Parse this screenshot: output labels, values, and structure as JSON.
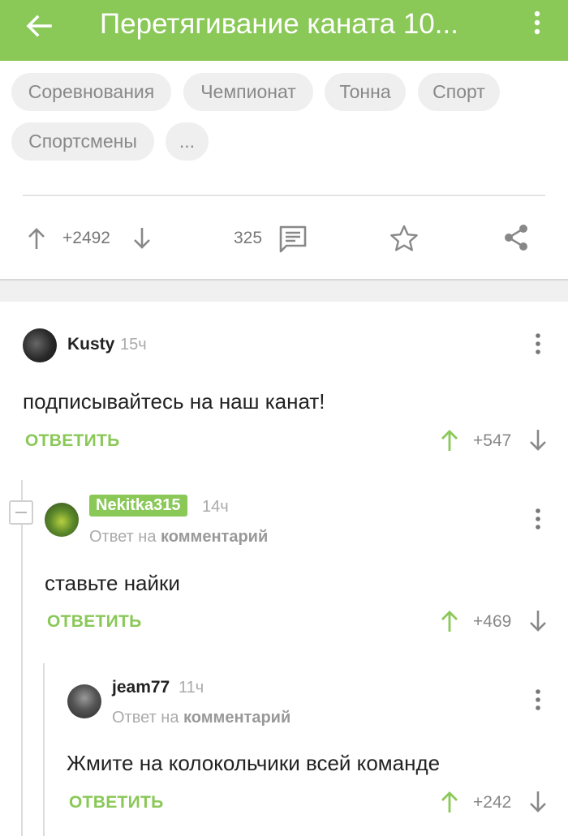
{
  "appbar": {
    "title": "Перетягивание каната 10..."
  },
  "tags": [
    "Соревнования",
    "Чемпионат",
    "Тонна",
    "Спорт",
    "Спортсмены",
    "..."
  ],
  "post_stats": {
    "rating": "+2492",
    "comments_count": "325"
  },
  "comments": [
    {
      "username": "Kusty",
      "time": "15ч",
      "text": "подписывайтесь на наш канат!",
      "reply_label": "ОТВЕТИТЬ",
      "score": "+547"
    },
    {
      "username": "Nekitka315",
      "time": "14ч",
      "reply_prefix": "Ответ на",
      "reply_target": "комментарий",
      "text": "ставьте найки",
      "reply_label": "ОТВЕТИТЬ",
      "score": "+469"
    },
    {
      "username": "jeam77",
      "time": "11ч",
      "reply_prefix": "Ответ на",
      "reply_target": "комментарий",
      "text": "Жмите на колокольчики всей команде",
      "reply_label": "ОТВЕТИТЬ",
      "score": "+242"
    }
  ],
  "colors": {
    "accent": "#8ac858",
    "appbar": "#8ac858",
    "muted": "#aaaaaa"
  },
  "icons": [
    "back-arrow-icon",
    "more-vert-icon",
    "arrow-up-icon",
    "arrow-down-icon",
    "comment-icon",
    "star-icon",
    "share-icon",
    "collapse-icon"
  ]
}
